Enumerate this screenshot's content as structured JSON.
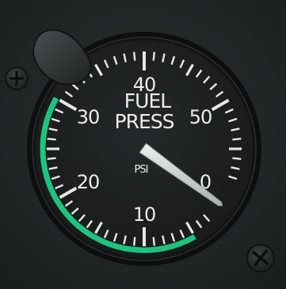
{
  "gauge": {
    "title_line1": "FUEL",
    "title_line2": "PRESS",
    "unit": "PSI",
    "dial_numbers": [
      "10",
      "20",
      "30",
      "40",
      "50"
    ],
    "partial_numeral": "0",
    "reading_psi": 61,
    "green_arc_psi": [
      5,
      30
    ],
    "colors": {
      "panel": "#24282a",
      "bezel": "#0e0f10",
      "face": "#1c1f21",
      "markings": "#e6e6e6",
      "green_arc": "#1ec47e",
      "needle": "#d2d6d6"
    }
  },
  "panel": {
    "left_screw_icon": "screw-icon",
    "right_screw_icon": "screw-icon",
    "knob_icon": "knob-icon"
  }
}
